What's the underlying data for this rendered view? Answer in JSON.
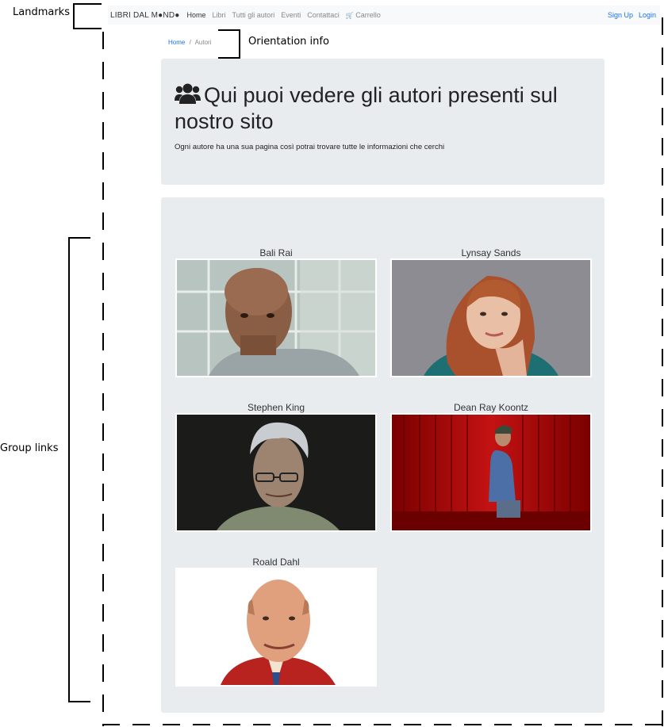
{
  "annotations": {
    "landmarks": "Landmarks",
    "orientation": "Orientation info",
    "group_links": "Group links"
  },
  "navbar": {
    "brand": "LIBRI DAL M●ND●",
    "links": [
      "Home",
      "Libri",
      "Tutti gli autori",
      "Eventi",
      "Contattaci",
      "Carrello"
    ],
    "right_links": [
      "Sign Up",
      "Login"
    ]
  },
  "breadcrumb": {
    "items": [
      "Home",
      "Autori"
    ],
    "separator": "/"
  },
  "header": {
    "title": "Qui puoi vedere gli autori presenti sul nostro sito",
    "subtitle": "Ogni autore ha una sua pagina così potrai trovare tutte le informazioni che cerchi"
  },
  "authors": [
    {
      "name": "Bali Rai"
    },
    {
      "name": "Lynsay Sands"
    },
    {
      "name": "Stephen King"
    },
    {
      "name": "Dean Ray Koontz"
    },
    {
      "name": "Roald Dahl"
    }
  ],
  "colors": {
    "link": "#1a73e8",
    "panel": "#e9ecef",
    "navbar": "#f8f9fa"
  }
}
